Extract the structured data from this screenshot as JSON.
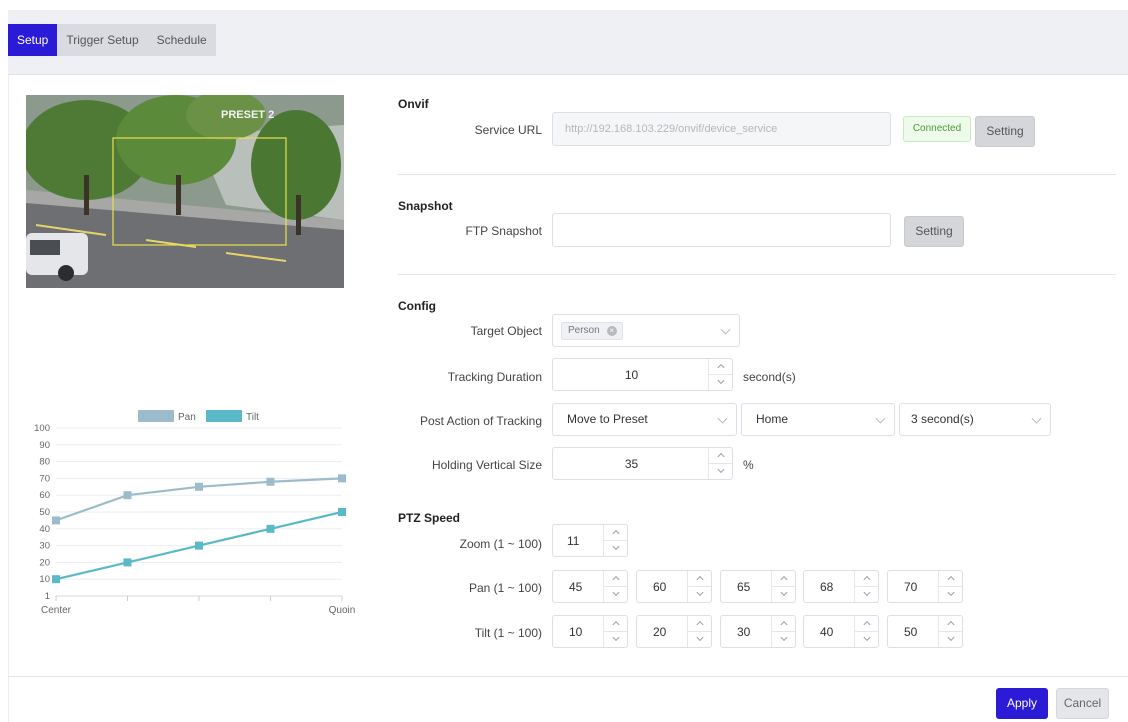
{
  "tabs": [
    {
      "label": "Setup",
      "active": true
    },
    {
      "label": "Trigger Setup",
      "active": false
    },
    {
      "label": "Schedule",
      "active": false
    }
  ],
  "preview": {
    "overlay_text": "PRESET 2"
  },
  "onvif": {
    "title": "Onvif",
    "service_url_label": "Service URL",
    "service_url_value": "http://192.168.103.229/onvif/device_service",
    "status": "Connected",
    "setting_label": "Setting"
  },
  "snapshot": {
    "title": "Snapshot",
    "ftp_label": "FTP Snapshot",
    "ftp_value": "",
    "setting_label": "Setting"
  },
  "config": {
    "title": "Config",
    "target_label": "Target Object",
    "target_tag": "Person",
    "duration_label": "Tracking Duration",
    "duration_value": "10",
    "duration_unit": "second(s)",
    "post_action_label": "Post Action of Tracking",
    "post_action_value": "Move to Preset",
    "preset_value": "Home",
    "delay_value": "3 second(s)",
    "vertical_label": "Holding Vertical Size",
    "vertical_value": "35",
    "vertical_unit": "%"
  },
  "ptz": {
    "title": "PTZ Speed",
    "zoom_label": "Zoom (1 ~ 100)",
    "zoom_value": "11",
    "pan_label": "Pan (1 ~ 100)",
    "pan_values": [
      "45",
      "60",
      "65",
      "68",
      "70"
    ],
    "tilt_label": "Tilt (1 ~ 100)",
    "tilt_values": [
      "10",
      "20",
      "30",
      "40",
      "50"
    ]
  },
  "footer": {
    "apply": "Apply",
    "cancel": "Cancel"
  },
  "colors": {
    "accent": "#2b1bd6",
    "pan": "#9dbccb",
    "tilt": "#5bb8c7"
  },
  "chart_data": {
    "type": "line",
    "categories": [
      "Center",
      "",
      "",
      "",
      "Quoin"
    ],
    "series": [
      {
        "name": "Pan",
        "values": [
          45,
          60,
          65,
          68,
          70
        ],
        "color": "#9dbccb"
      },
      {
        "name": "Tilt",
        "values": [
          10,
          20,
          30,
          40,
          50
        ],
        "color": "#5bb8c7"
      }
    ],
    "yticks": [
      "100",
      "90",
      "80",
      "70",
      "60",
      "50",
      "40",
      "30",
      "20",
      "10",
      "1"
    ],
    "ylim": [
      0,
      100
    ],
    "legend": "top",
    "grid": true
  }
}
